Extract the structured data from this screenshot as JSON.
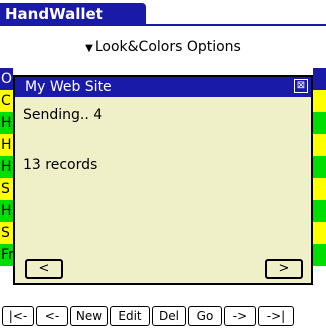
{
  "app": {
    "title": "HandWallet"
  },
  "menu": {
    "label": "Look&Colors Options"
  },
  "list": {
    "rows": [
      {
        "text": "O",
        "color": "#1a1aa8",
        "text_color": "#ffffff"
      },
      {
        "text": "C",
        "color": "#ffff00",
        "text_color": "#000000"
      },
      {
        "text": "H",
        "color": "#00dd00",
        "text_color": "#000000"
      },
      {
        "text": "H",
        "color": "#ffff00",
        "text_color": "#000000"
      },
      {
        "text": "H",
        "color": "#00dd00",
        "text_color": "#000000"
      },
      {
        "text": "S",
        "color": "#ffff00",
        "text_color": "#000000"
      },
      {
        "text": "H",
        "color": "#00dd00",
        "text_color": "#000000"
      },
      {
        "text": "S",
        "color": "#ffff00",
        "text_color": "#000000"
      },
      {
        "text": "Fr",
        "color": "#00dd00",
        "text_color": "#000000"
      }
    ]
  },
  "dialog": {
    "title": "My Web Site",
    "close_symbol": "⊠",
    "status_line": "Sending.. 4",
    "records_line": "13 records",
    "prev_label": "<",
    "next_label": ">"
  },
  "toolbar": {
    "buttons": [
      "|<-",
      "<-",
      "New",
      "Edit",
      "Del",
      "Go",
      "->",
      "->|"
    ]
  },
  "colors": {
    "accent": "#1a1aa8",
    "dialog_bg": "#f0f0c8"
  }
}
